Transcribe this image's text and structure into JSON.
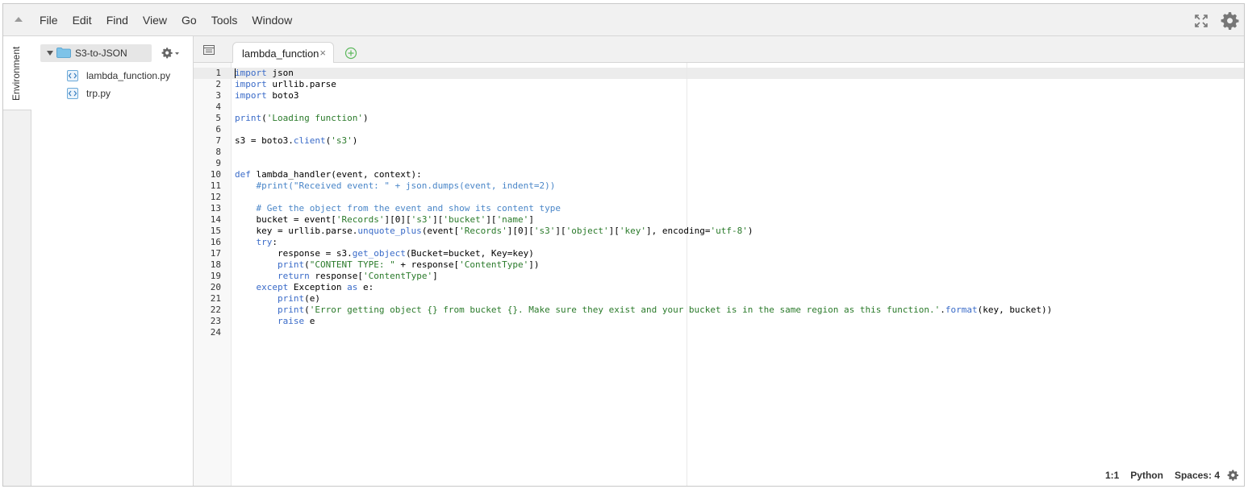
{
  "menu": {
    "items": [
      "File",
      "Edit",
      "Find",
      "View",
      "Go",
      "Tools",
      "Window"
    ]
  },
  "sidebar": {
    "tab_label": "Environment",
    "root_folder": "S3-to-JSON",
    "files": [
      "lambda_function.py",
      "trp.py"
    ]
  },
  "tabs": {
    "active": "lambda_function",
    "close_symbol": "×"
  },
  "editor": {
    "language": "Python",
    "lines": [
      "import json",
      "import urllib.parse",
      "import boto3",
      "",
      "print('Loading function')",
      "",
      "s3 = boto3.client('s3')",
      "",
      "",
      "def lambda_handler(event, context):",
      "    #print(\"Received event: \" + json.dumps(event, indent=2))",
      "",
      "    # Get the object from the event and show its content type",
      "    bucket = event['Records'][0]['s3']['bucket']['name']",
      "    key = urllib.parse.unquote_plus(event['Records'][0]['s3']['object']['key'], encoding='utf-8')",
      "    try:",
      "        response = s3.get_object(Bucket=bucket, Key=key)",
      "        print(\"CONTENT TYPE: \" + response['ContentType'])",
      "        return response['ContentType']",
      "    except Exception as e:",
      "        print(e)",
      "        print('Error getting object {} from bucket {}. Make sure they exist and your bucket is in the same region as this function.'.format(key, bucket))",
      "        raise e",
      ""
    ]
  },
  "status": {
    "position": "1:1",
    "language": "Python",
    "spaces": "Spaces: 4"
  },
  "colors": {
    "keyword": "#3a6bc8",
    "string": "#2a7a2a",
    "comment": "#4a86c8",
    "folder": "#7ec3e8"
  }
}
